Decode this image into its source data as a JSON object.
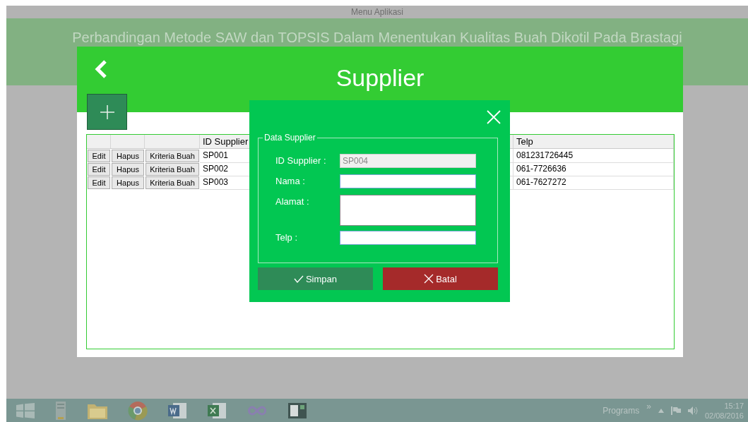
{
  "window": {
    "title": "Menu Aplikasi"
  },
  "headline": "Perbandingan Metode SAW dan TOPSIS Dalam Menentukan Kualitas Buah Dikotil Pada Brastagi",
  "supplier_window": {
    "title": "Supplier",
    "table": {
      "columns": [
        "ID Supplier",
        "Telp"
      ],
      "rows": [
        {
          "actions": [
            "Edit",
            "Hapus",
            "Kriteria Buah"
          ],
          "id": "SP001",
          "telp": "081231726445"
        },
        {
          "actions": [
            "Edit",
            "Hapus",
            "Kriteria Buah"
          ],
          "id": "SP002",
          "telp": "061-7726636"
        },
        {
          "actions": [
            "Edit",
            "Hapus",
            "Kriteria Buah"
          ],
          "id": "SP003",
          "telp": "061-7627272"
        }
      ]
    }
  },
  "dialog": {
    "group_title": "Data Supplier",
    "fields": [
      {
        "kind": "input",
        "label": "ID Supplier :",
        "value": "SP004",
        "disabled": true
      },
      {
        "kind": "input",
        "label": "Nama :",
        "disabled": false
      },
      {
        "kind": "textarea",
        "label": "Alamat :",
        "disabled": false
      },
      {
        "kind": "input",
        "label": "Telp :",
        "disabled": false
      }
    ],
    "buttons": [
      {
        "kind": "save",
        "label": "Simpan"
      },
      {
        "kind": "cancel",
        "label": "Batal"
      }
    ]
  },
  "taskbar": {
    "programs": "Programs",
    "chevron": "»",
    "time": "15:17",
    "date": "02/08/2016"
  }
}
